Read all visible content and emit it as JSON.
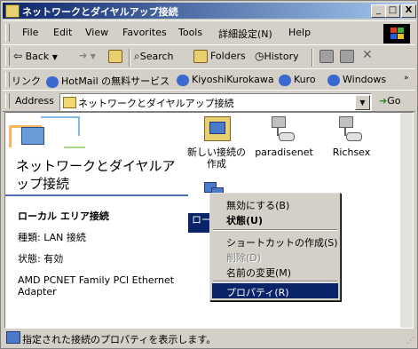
{
  "window": {
    "title": "ネットワークとダイヤルアップ接続",
    "controls": {
      "minimize": "_",
      "maximize": "□",
      "close": "X"
    }
  },
  "menubar": {
    "items": [
      {
        "label": "File"
      },
      {
        "label": "Edit"
      },
      {
        "label": "View"
      },
      {
        "label": "Favorites"
      },
      {
        "label": "Tools"
      },
      {
        "label": "詳細設定(N)"
      },
      {
        "label": "Help"
      }
    ]
  },
  "toolbar": {
    "back_label": "Back",
    "forward_glyph": "➔",
    "search_label": "Search",
    "folders_label": "Folders",
    "history_label": "History",
    "delete_glyph": "✕"
  },
  "links": {
    "title": "リンク",
    "items": [
      {
        "label": "HotMail の無料サービス"
      },
      {
        "label": "KiyoshiKurokawa"
      },
      {
        "label": "Kuro"
      },
      {
        "label": "Windows"
      }
    ]
  },
  "address": {
    "label": "Address",
    "value": "ネットワークとダイヤルアップ接続",
    "go_label": "Go"
  },
  "panel": {
    "title": "ネットワークとダイヤルアップ接続",
    "conn_name": "ローカル エリア接続",
    "type_line": "種類: LAN 接続",
    "status_line": "状態: 有効",
    "adapter_line1": "AMD PCNET Family PCI Ethernet",
    "adapter_line2": "Adapter"
  },
  "icons": [
    {
      "label_line1": "新しい接続の",
      "label_line2": "作成"
    },
    {
      "label_line1": "paradisenet"
    },
    {
      "label_line1": "Richsex"
    },
    {
      "label_line1": "ローカ"
    }
  ],
  "context_menu": {
    "items": [
      {
        "label": "無効にする(B)",
        "style": "normal"
      },
      {
        "label": "状態(U)",
        "style": "bold"
      },
      {
        "label": "ショートカットの作成(S)",
        "style": "normal"
      },
      {
        "label": "削除(D)",
        "style": "disabled"
      },
      {
        "label": "名前の変更(M)",
        "style": "normal"
      },
      {
        "label": "プロパティ(R)",
        "style": "selected"
      }
    ]
  },
  "status": {
    "text": "指定された接続のプロパティを表示します。"
  },
  "colors": {
    "titlebar_start": "#0a246a",
    "titlebar_end": "#a6caf0",
    "selection": "#0a246a",
    "face": "#d4d0c8",
    "panel_rule": "#4e6fb3"
  }
}
